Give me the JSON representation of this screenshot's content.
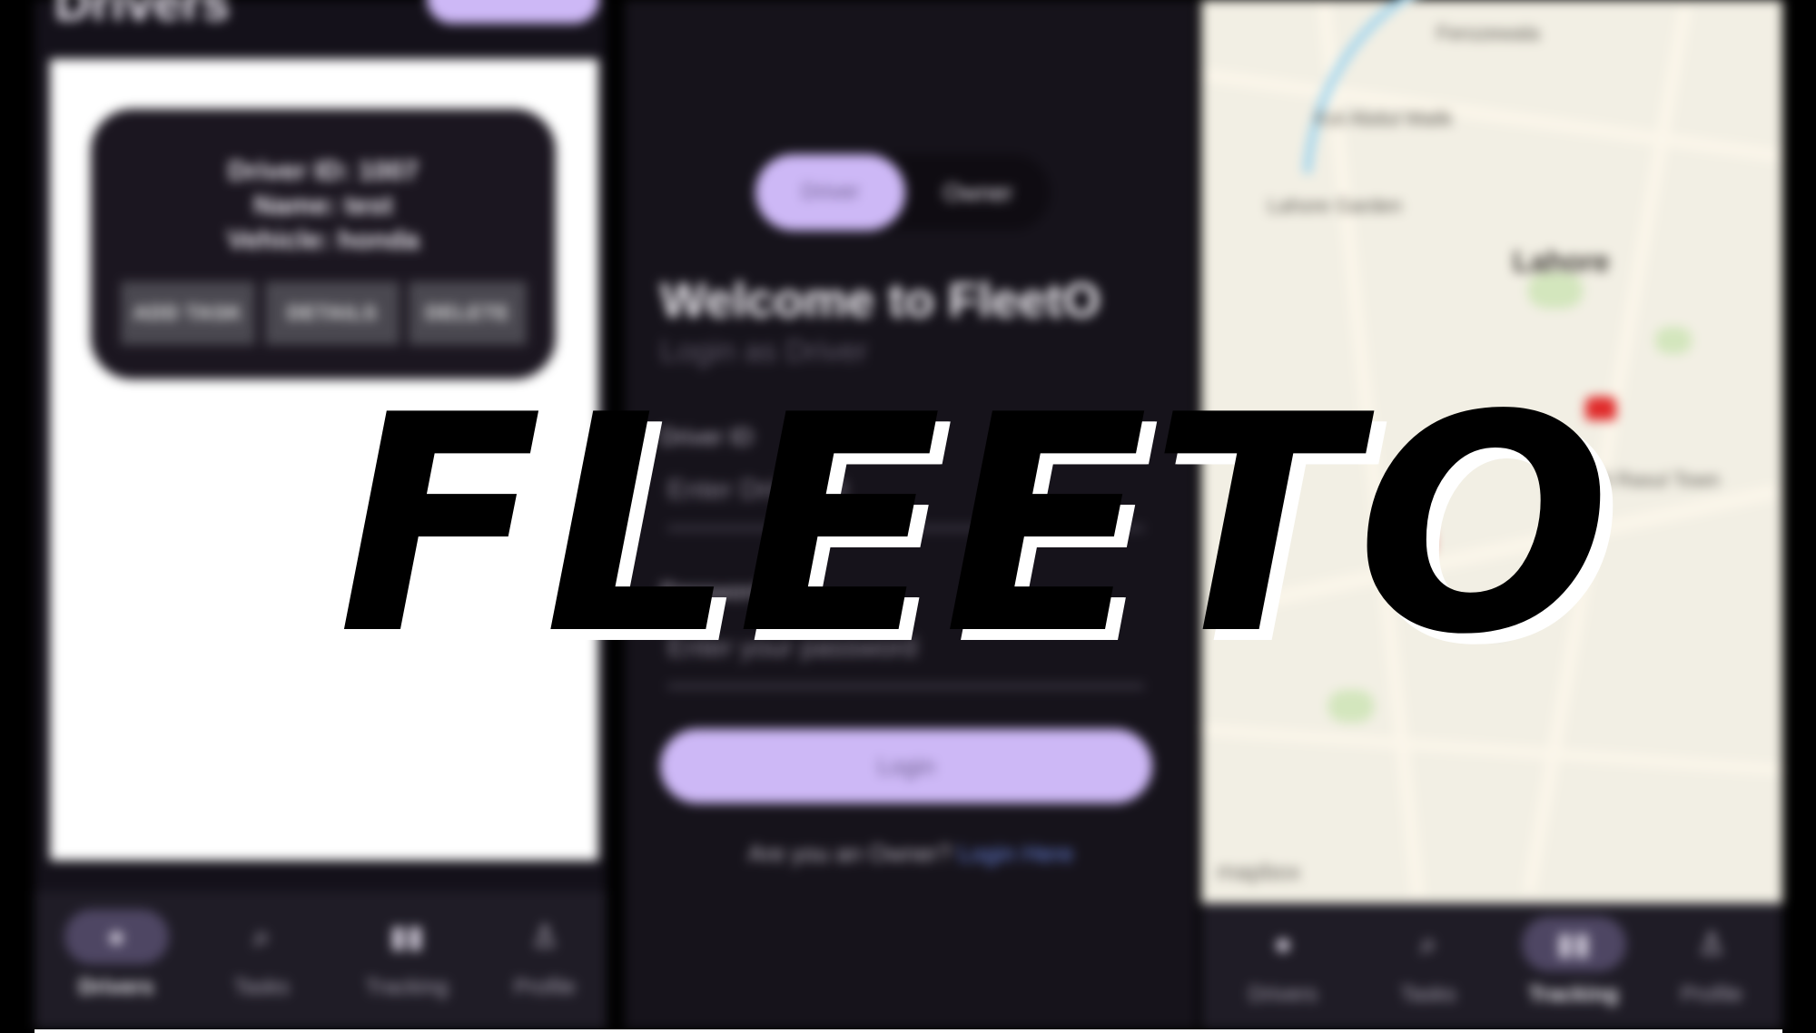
{
  "headline": "FLEETO",
  "left_screen": {
    "title": "Drivers",
    "driver_card": {
      "driver_id": "Driver ID: 1007",
      "name": "Name: test",
      "vehicle": "Vehicle: honda",
      "buttons": [
        "ADD TASK",
        "DETAILS",
        "DELETE"
      ]
    }
  },
  "login_screen": {
    "role_toggle": {
      "driver": "Driver",
      "owner": "Owner"
    },
    "welcome": "Welcome to FleetO",
    "subtitle": "Login as Driver",
    "driver_id_label": "Driver ID",
    "driver_id_placeholder": "Enter Driver ID",
    "password_label": "Password",
    "password_placeholder": "Enter your password",
    "login_button": "Login",
    "owner_prompt": "Are you an Owner?",
    "owner_link": "Login Here"
  },
  "map_screen": {
    "labels": [
      "Ferozewala",
      "Kot Abdul Malik",
      "Lahore Garden",
      "Lahore",
      "Al Rasul Town"
    ],
    "attribution": "mapbox"
  },
  "bottom_nav": {
    "items": [
      {
        "label": "Drivers",
        "icon": "person-icon"
      },
      {
        "label": "Tasks",
        "icon": "search-icon"
      },
      {
        "label": "Tracking",
        "icon": "map-icon"
      },
      {
        "label": "Profile",
        "icon": "profile-icon"
      }
    ],
    "left_active": "Drivers",
    "right_active": "Tracking"
  },
  "colors": {
    "accent": "#cdb8f6",
    "dark_bg": "#16131b",
    "link": "#6a85e0"
  }
}
